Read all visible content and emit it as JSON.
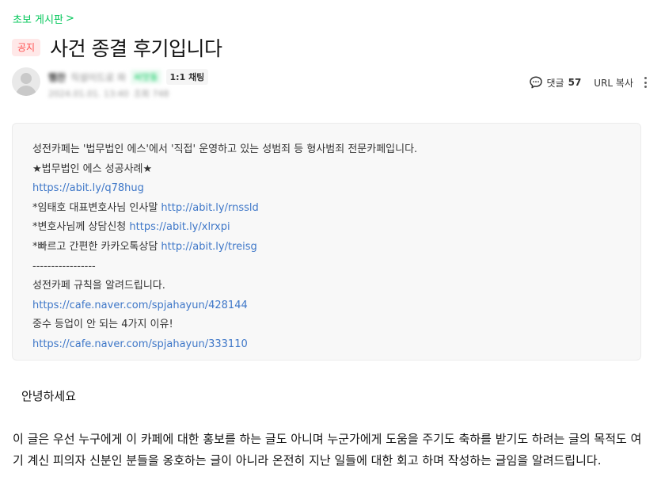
{
  "board": {
    "name": "초보 게시판",
    "chevron": ">"
  },
  "post": {
    "badge": "공지",
    "title": "사건 종결 후기입니다",
    "author": {
      "nickname": "햄찬",
      "grade": "직설이드로 파",
      "level": "씨앗동",
      "chat_label": "1:1 채팅",
      "date": "2024.01.01. 13:40",
      "views": "조회 748"
    }
  },
  "tools": {
    "comment_label": "댓글",
    "comment_count": "57",
    "url_copy": "URL 복사"
  },
  "notice_box": {
    "lines": [
      {
        "text": "성전카페는 '법무법인 에스'에서 '직접' 운영하고 있는 성범죄 등 형사범죄 전문카페입니다.",
        "link": ""
      },
      {
        "text": "★법무법인 에스 성공사례★",
        "link": ""
      },
      {
        "text": "",
        "link": "https://abit.ly/q78hug"
      },
      {
        "text": "*임태호 대표변호사님 인사말 ",
        "link": "http://abit.ly/rnssld"
      },
      {
        "text": "*변호사님께 상담신청 ",
        "link": "https://abit.ly/xlrxpi"
      },
      {
        "text": "*빠르고 간편한 카카오톡상담 ",
        "link": "http://abit.ly/treisg"
      },
      {
        "text": "-----------------",
        "link": ""
      },
      {
        "text": "성전카페 규칙을 알려드립니다.",
        "link": ""
      },
      {
        "text": "",
        "link": "https://cafe.naver.com/spjahayun/428144"
      },
      {
        "text": "중수 등업이 안 되는 4가지 이유!",
        "link": ""
      },
      {
        "text": "",
        "link": "https://cafe.naver.com/spjahayun/333110"
      }
    ]
  },
  "content": {
    "greeting": "안녕하세요",
    "paragraph": "이 글은 우선 누구에게 이 카페에 대한 홍보를 하는 글도 아니며 누군가에게 도움을 주기도 축하를 받기도 하려는 글의 목적도 여기 계신 피의자 신분인 분들을 옹호하는 글이 아니라 온전히 지난 일들에 대한 회고 하며 작성하는 글임을 알려드립니다."
  }
}
